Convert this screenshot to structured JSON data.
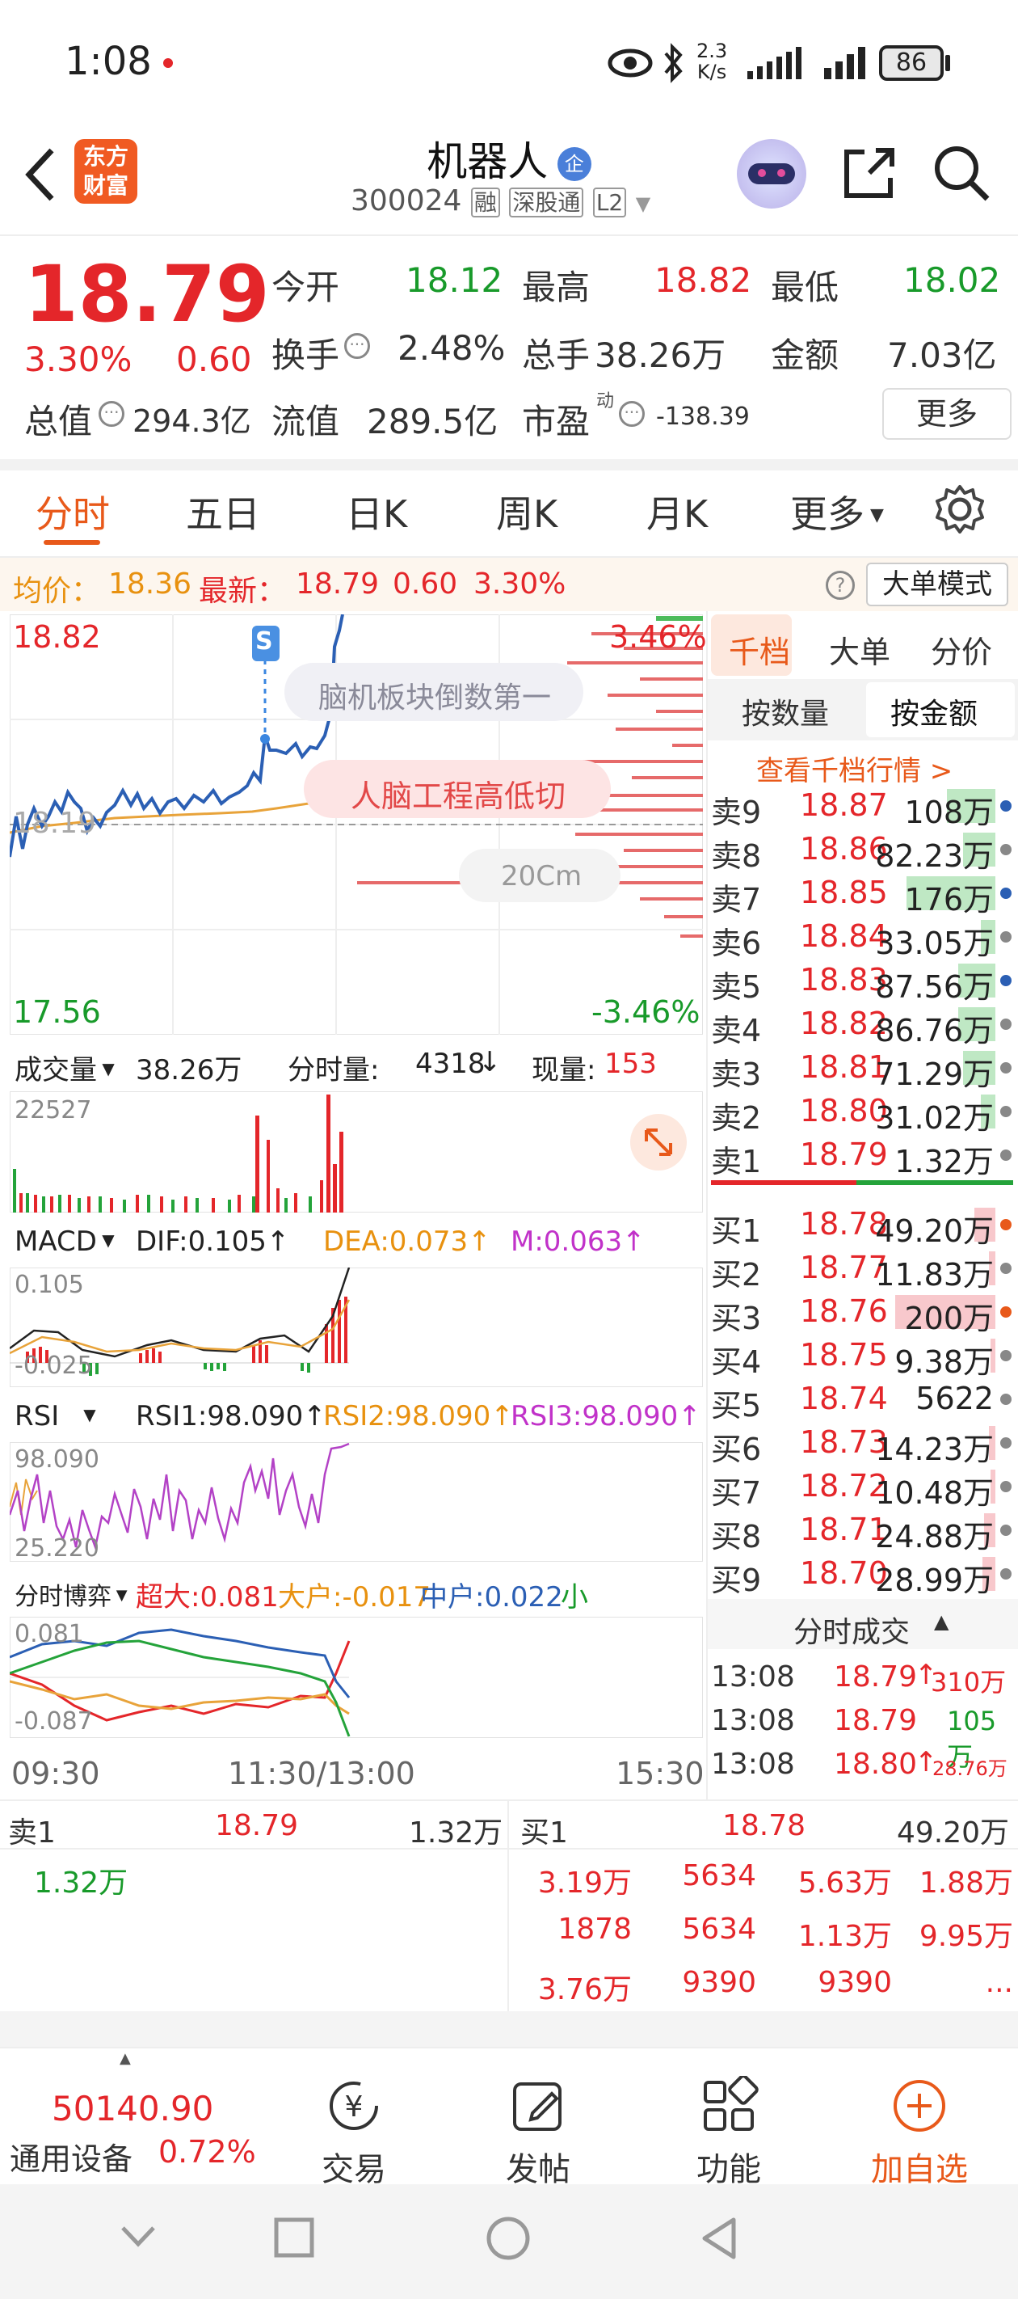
{
  "status": {
    "time": "1:08",
    "net_speed": "2.3",
    "net_unit": "K/s",
    "battery": "86"
  },
  "header": {
    "title": "机器人",
    "badge": "企",
    "code": "300024",
    "tags": [
      "融",
      "深股通",
      "L2"
    ],
    "logo_line1": "东方",
    "logo_line2": "财富"
  },
  "quote": {
    "price": "18.79",
    "pct": "3.30%",
    "chg": "0.60",
    "open_label": "今开",
    "open": "18.12",
    "high_label": "最高",
    "high": "18.82",
    "low_label": "最低",
    "low": "18.02",
    "turnover_label": "换手",
    "turnover": "2.48%",
    "vol_label": "总手",
    "vol": "38.26万",
    "amount_label": "金额",
    "amount": "7.03亿",
    "mcap_label": "总值",
    "mcap": "294.3亿",
    "float_label": "流值",
    "float": "289.5亿",
    "pe_label": "市盈",
    "pe_sup": "动",
    "pe": "-138.39",
    "more": "更多"
  },
  "tabs": [
    "分时",
    "五日",
    "日K",
    "周K",
    "月K",
    "更多"
  ],
  "infobar": {
    "avg_label": "均价：",
    "avg": "18.36",
    "latest_label": "最新：",
    "latest": "18.79",
    "chg": "0.60",
    "pct": "3.30%",
    "mode": "大单模式"
  },
  "chart": {
    "top_price": "18.82",
    "top_pct": "3.46%",
    "bottom_price": "17.56",
    "bottom_pct": "-3.46%",
    "mid_price": "18.19",
    "ann1": "脑机板块倒数第一",
    "ann2": "人脑工程高低切",
    "ann3": "20Cm",
    "marker": "S",
    "times": [
      "09:30",
      "11:30/13:00",
      "15:30"
    ]
  },
  "volume": {
    "label": "成交量",
    "total": "38.26万",
    "period_label": "分时量:",
    "period": "4318",
    "period_arrow": "↓",
    "now_label": "现量:",
    "now": "153",
    "max": "22527"
  },
  "macd": {
    "label": "MACD",
    "dif": "DIF:0.105↑",
    "dea": "DEA:0.073↑",
    "m": "M:0.063↑",
    "top": "0.105",
    "bottom": "-0.025"
  },
  "rsi": {
    "label": "RSI",
    "rsi1": "RSI1:98.090↑",
    "rsi2": "RSI2:98.090↑",
    "rsi3": "RSI3:98.090↑",
    "top": "98.090",
    "bottom": "25.220"
  },
  "flow": {
    "label": "分时博弈",
    "xl": "超大:0.081",
    "l": "大户:-0.017",
    "m": "中户:0.022",
    "s": "小户:-0.087",
    "top": "0.081",
    "bottom": "-0.087"
  },
  "orderbook": {
    "tabs": [
      "千档",
      "大单",
      "分价"
    ],
    "sub_tabs": [
      "按数量",
      "按金额"
    ],
    "link": "查看千档行情 >",
    "asks": [
      {
        "label": "卖9",
        "price": "18.87",
        "vol": "108万"
      },
      {
        "label": "卖8",
        "price": "18.86",
        "vol": "82.23万"
      },
      {
        "label": "卖7",
        "price": "18.85",
        "vol": "176万"
      },
      {
        "label": "卖6",
        "price": "18.84",
        "vol": "33.05万"
      },
      {
        "label": "卖5",
        "price": "18.83",
        "vol": "87.56万"
      },
      {
        "label": "卖4",
        "price": "18.82",
        "vol": "86.76万"
      },
      {
        "label": "卖3",
        "price": "18.81",
        "vol": "71.29万"
      },
      {
        "label": "卖2",
        "price": "18.80",
        "vol": "31.02万"
      },
      {
        "label": "卖1",
        "price": "18.79",
        "vol": "1.32万"
      }
    ],
    "bids": [
      {
        "label": "买1",
        "price": "18.78",
        "vol": "49.20万"
      },
      {
        "label": "买2",
        "price": "18.77",
        "vol": "11.83万"
      },
      {
        "label": "买3",
        "price": "18.76",
        "vol": "200万"
      },
      {
        "label": "买4",
        "price": "18.75",
        "vol": "9.38万"
      },
      {
        "label": "买5",
        "price": "18.74",
        "vol": "5622"
      },
      {
        "label": "买6",
        "price": "18.73",
        "vol": "14.23万"
      },
      {
        "label": "买7",
        "price": "18.72",
        "vol": "10.48万"
      },
      {
        "label": "买8",
        "price": "18.71",
        "vol": "24.88万"
      },
      {
        "label": "买9",
        "price": "18.70",
        "vol": "28.99万"
      }
    ],
    "trades_title": "分时成交",
    "trades": [
      {
        "time": "13:08",
        "price": "18.79",
        "arrow": "↑",
        "vol": "310万"
      },
      {
        "time": "13:08",
        "price": "18.79",
        "arrow": "",
        "vol": "105万"
      },
      {
        "time": "13:08",
        "price": "18.80",
        "arrow": "↑",
        "vol": "28.76万"
      }
    ]
  },
  "queue": {
    "ask_label": "卖1",
    "ask_price": "18.79",
    "ask_vol": "1.32万",
    "ask_items": [
      "1.32万"
    ],
    "bid_label": "买1",
    "bid_price": "18.78",
    "bid_vol": "49.20万",
    "bid_items": [
      "3.19万",
      "5634",
      "5.63万",
      "1.88万",
      "1878",
      "5634",
      "1.13万",
      "9.95万",
      "3.76万",
      "9390",
      "9390",
      "..."
    ]
  },
  "bottom": {
    "index_value": "50140.90",
    "index_name": "通用设备",
    "index_pct": "0.72%",
    "nav": [
      "交易",
      "发帖",
      "功能",
      "加自选"
    ]
  }
}
